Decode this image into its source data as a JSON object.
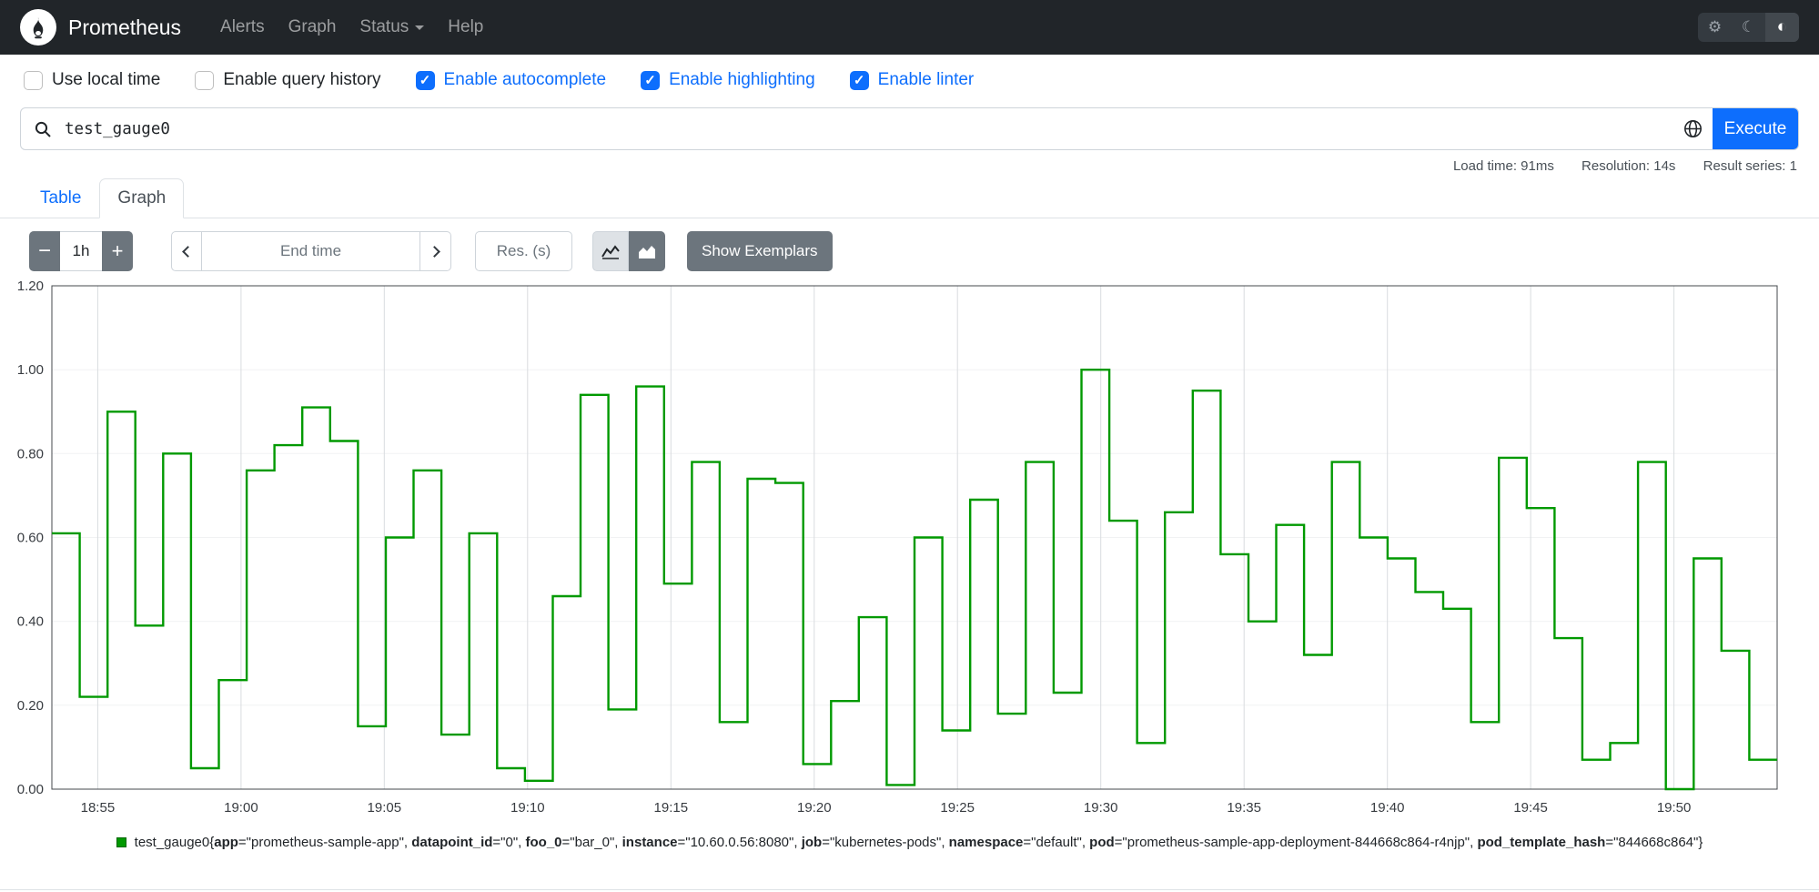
{
  "navbar": {
    "brand": "Prometheus",
    "items": [
      "Alerts",
      "Graph",
      "Status",
      "Help"
    ],
    "theme_icons": {
      "settings": "⚙",
      "dark": "☾",
      "auto": "◐"
    }
  },
  "options": [
    {
      "label": "Use local time",
      "checked": false
    },
    {
      "label": "Enable query history",
      "checked": false
    },
    {
      "label": "Enable autocomplete",
      "checked": true
    },
    {
      "label": "Enable highlighting",
      "checked": true
    },
    {
      "label": "Enable linter",
      "checked": true
    }
  ],
  "ui": {
    "check_glyph": "✓"
  },
  "query": {
    "value": "test_gauge0",
    "execute_label": "Execute"
  },
  "stats": [
    {
      "label": "Load time:",
      "value": "91ms"
    },
    {
      "label": "Resolution:",
      "value": "14s"
    },
    {
      "label": "Result series:",
      "value": "1"
    }
  ],
  "tabs": [
    {
      "label": "Table",
      "active": false
    },
    {
      "label": "Graph",
      "active": true
    }
  ],
  "controls": {
    "decrease_label": "−",
    "range_value": "1h",
    "increase_label": "+",
    "end_time_placeholder": "End time",
    "resolution_placeholder": "Res. (s)",
    "show_exemplars_label": "Show Exemplars"
  },
  "chart_data": {
    "type": "line",
    "step": true,
    "title": "",
    "xlabel": "",
    "ylabel": "",
    "ylim": [
      0,
      1.2
    ],
    "grid": true,
    "x_domain_minutes": [
      1133.4,
      1193.6
    ],
    "y_ticks": [
      "0.00",
      "0.20",
      "0.40",
      "0.60",
      "0.80",
      "1.00",
      "1.20"
    ],
    "x_ticks": [
      {
        "m": 1135,
        "label": "18:55"
      },
      {
        "m": 1140,
        "label": "19:00"
      },
      {
        "m": 1145,
        "label": "19:05"
      },
      {
        "m": 1150,
        "label": "19:10"
      },
      {
        "m": 1155,
        "label": "19:15"
      },
      {
        "m": 1160,
        "label": "19:20"
      },
      {
        "m": 1165,
        "label": "19:25"
      },
      {
        "m": 1170,
        "label": "19:30"
      },
      {
        "m": 1175,
        "label": "19:35"
      },
      {
        "m": 1180,
        "label": "19:40"
      },
      {
        "m": 1185,
        "label": "19:45"
      },
      {
        "m": 1190,
        "label": "19:50"
      }
    ],
    "series": [
      {
        "name": "test_gauge0",
        "color": "#009900",
        "values": [
          0.61,
          0.22,
          0.9,
          0.39,
          0.8,
          0.05,
          0.26,
          0.76,
          0.82,
          0.91,
          0.83,
          0.15,
          0.6,
          0.76,
          0.13,
          0.61,
          0.05,
          0.02,
          0.46,
          0.94,
          0.19,
          0.96,
          0.49,
          0.78,
          0.16,
          0.74,
          0.73,
          0.06,
          0.21,
          0.41,
          0.01,
          0.6,
          0.14,
          0.69,
          0.18,
          0.78,
          0.23,
          1.0,
          0.64,
          0.11,
          0.66,
          0.95,
          0.56,
          0.4,
          0.63,
          0.32,
          0.78,
          0.6,
          0.55,
          0.47,
          0.43,
          0.16,
          0.79,
          0.67,
          0.36,
          0.07,
          0.11,
          0.78,
          0.0,
          0.55,
          0.33,
          0.07
        ]
      }
    ]
  },
  "legend": {
    "metric": "test_gauge0",
    "labels": [
      {
        "name": "app",
        "value": "prometheus-sample-app"
      },
      {
        "name": "datapoint_id",
        "value": "0"
      },
      {
        "name": "foo_0",
        "value": "bar_0"
      },
      {
        "name": "instance",
        "value": "10.60.0.56:8080"
      },
      {
        "name": "job",
        "value": "kubernetes-pods"
      },
      {
        "name": "namespace",
        "value": "default"
      },
      {
        "name": "pod",
        "value": "prometheus-sample-app-deployment-844668c864-r4njp"
      },
      {
        "name": "pod_template_hash",
        "value": "844668c864"
      }
    ]
  }
}
